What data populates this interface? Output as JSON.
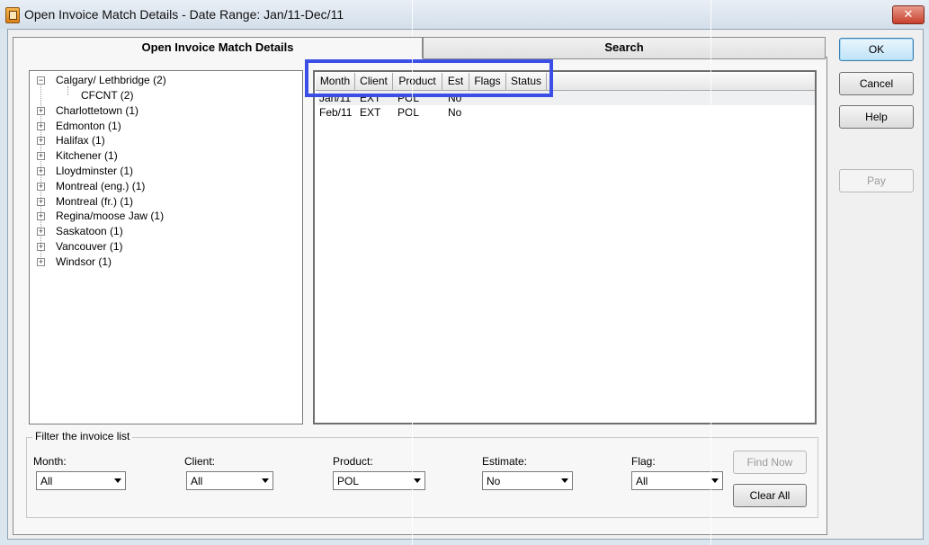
{
  "window": {
    "title": "Open Invoice Match Details - Date Range: Jan/11-Dec/11"
  },
  "tabs": [
    {
      "label": "Open Invoice Match Details",
      "active": true
    },
    {
      "label": "Search",
      "active": false
    }
  ],
  "tree": {
    "root": {
      "label": "Calgary/ Lethbridge",
      "count": "(2)",
      "expanded": true,
      "children": [
        {
          "label": "CFCNT",
          "count": "(2)"
        }
      ]
    },
    "items": [
      {
        "label": "Charlottetown",
        "count": "(1)"
      },
      {
        "label": "Edmonton",
        "count": "(1)"
      },
      {
        "label": "Halifax",
        "count": "(1)"
      },
      {
        "label": "Kitchener",
        "count": "(1)"
      },
      {
        "label": "Lloydminster",
        "count": "(1)"
      },
      {
        "label": "Montreal (eng.)",
        "count": "(1)"
      },
      {
        "label": "Montreal (fr.)",
        "count": "(1)"
      },
      {
        "label": "Regina/moose Jaw",
        "count": "(1)"
      },
      {
        "label": "Saskatoon",
        "count": "(1)"
      },
      {
        "label": "Vancouver",
        "count": "(1)"
      },
      {
        "label": "Windsor",
        "count": "(1)"
      }
    ]
  },
  "grid": {
    "columns": [
      "Month",
      "Client",
      "Product",
      "Est",
      "Flags",
      "Status"
    ],
    "rows": [
      {
        "month": "Jan/11",
        "client": "EXT",
        "product": "POL",
        "est": "No"
      },
      {
        "month": "Feb/11",
        "client": "EXT",
        "product": "POL",
        "est": "No"
      }
    ]
  },
  "buttons": {
    "ok": "OK",
    "cancel": "Cancel",
    "help": "Help",
    "pay": "Pay",
    "find_now": "Find Now",
    "clear_all": "Clear All"
  },
  "filter": {
    "group_label": "Filter the invoice list",
    "month": {
      "label": "Month:",
      "value": "All"
    },
    "client": {
      "label": "Client:",
      "value": "All"
    },
    "product": {
      "label": "Product:",
      "value": "POL"
    },
    "estimate": {
      "label": "Estimate:",
      "value": "No"
    },
    "flag": {
      "label": "Flag:",
      "value": "All"
    }
  },
  "colors": {
    "highlight": "#3b4fe6",
    "close_button": "#c8402c"
  }
}
